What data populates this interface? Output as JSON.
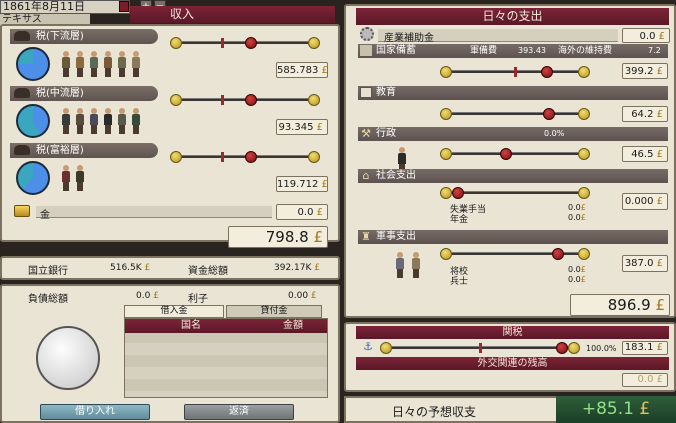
{
  "header": {
    "date": "1861年8月11日",
    "region": "テキサス",
    "income_title": "収入"
  },
  "income": {
    "rows": [
      {
        "label": "税(下流層)",
        "value": "585.783",
        "pie": 0.75,
        "slider": 0.55,
        "tick": 0.3
      },
      {
        "label": "税(中流層)",
        "value": "93.345",
        "pie": 0.42,
        "slider": 0.55,
        "tick": 0.3
      },
      {
        "label": "税(富裕層)",
        "value": "119.712",
        "pie": 0.62,
        "slider": 0.55,
        "tick": 0.3
      }
    ],
    "gold_label": "金",
    "gold_value": "0.0",
    "total": "798.8"
  },
  "bank": {
    "national_bank_label": "国立銀行",
    "national_bank_value": "516.5K",
    "fund_total_label": "資金総額",
    "fund_total_value": "392.17K"
  },
  "debt": {
    "total_label": "負債総額",
    "total_value": "0.0",
    "interest_label": "利子",
    "interest_value": "0.00",
    "tabs": [
      "借入金",
      "貸付金"
    ],
    "columns": [
      "国名",
      "金額"
    ],
    "borrow_label": "借り入れ",
    "repay_label": "返済"
  },
  "expense": {
    "title": "日々の支出",
    "subsidy_label": "産業補助金",
    "subsidy_value": "0.0",
    "defense": {
      "label": "国家備蓄",
      "sub1": "軍備費",
      "sub1_value": "393.43",
      "sub2": "海外の維持費",
      "sub2_value": "7.2",
      "value": "399.2",
      "slider": 0.78,
      "tick": 0.5
    },
    "education": {
      "label": "教育",
      "value": "64.2",
      "slider": 0.8
    },
    "admin": {
      "label": "行政",
      "percent": "0.0%",
      "value": "46.5",
      "slider": 0.42
    },
    "social": {
      "label": "社会支出",
      "sub1": "失業手当",
      "sub1_value": "0.0",
      "sub2": "年金",
      "sub2_value": "0.0",
      "value": "0.000",
      "slider": 0.0
    },
    "military": {
      "label": "軍事支出",
      "sub1": "将校",
      "sub1_value": "0.0",
      "sub2": "兵士",
      "sub2_value": "0.0",
      "value": "387.0",
      "slider": 0.88
    },
    "total": "896.9"
  },
  "tariff": {
    "title": "関税",
    "percent": "100.0%",
    "value": "183.1",
    "slider": 1.0,
    "tick": 0.5,
    "reserve_label": "外交関連の残高",
    "reserve_value": "0.0"
  },
  "forecast": {
    "label": "日々の予想収支",
    "value": "+85.1"
  },
  "currency": "£"
}
